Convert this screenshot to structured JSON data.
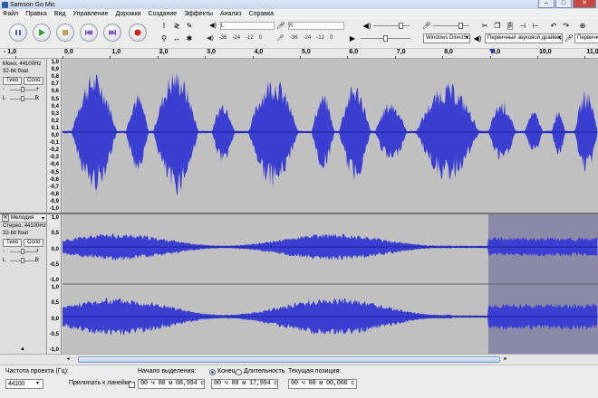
{
  "window": {
    "title": "Samson Go Mic",
    "min": "–",
    "max": "□",
    "close": "✕"
  },
  "menu": [
    "Файл",
    "Правка",
    "Вид",
    "Управление",
    "Дорожки",
    "Создание",
    "Эффекты",
    "Анализ",
    "Справка"
  ],
  "meters": {
    "play_scale": [
      "-36",
      "-24",
      "-12",
      "0"
    ],
    "rec_scale": [
      "-36",
      "-24",
      "-12",
      "0"
    ],
    "lr": [
      "L",
      "R"
    ]
  },
  "devices": {
    "host": "Windows DirectSo",
    "output": "Первичный звуковой драйвер",
    "input": "Первичный драйвер"
  },
  "ruler": {
    "ticks": [
      "- 1,0",
      "0,0",
      "1,0",
      "2,0",
      "3,0",
      "4,0",
      "5,0",
      "6,0",
      "7,0",
      "8,0",
      "9,0",
      "10,0",
      "11,0"
    ]
  },
  "track1": {
    "info": [
      "Моно, 44100Hz",
      "32-bit float"
    ],
    "mute": "Тихо",
    "solo": "Соло",
    "gain_minus": "-",
    "gain_plus": "+",
    "pan_l": "L",
    "pan_r": "R",
    "scale": [
      "1,0",
      "0,9",
      "0,8",
      "0,7",
      "0,6",
      "0,5",
      "0,4",
      "0,3",
      "0,2",
      "0,1",
      "0,0",
      "-0,1",
      "-0,2",
      "-0,3",
      "-0,4",
      "-0,5",
      "-0,6",
      "-0,7",
      "-0,8",
      "-0,9",
      "-1,0"
    ]
  },
  "track2": {
    "name": "Мелодия",
    "info": [
      "Стерео, 44100Hz",
      "32-bit float"
    ],
    "mute": "Тихо",
    "solo": "Соло",
    "gain_minus": "-",
    "gain_plus": "+",
    "pan_l": "L",
    "pan_r": "R",
    "scale_top": [
      "1,0",
      "0,5",
      "0,0",
      "-0,5",
      "-1,0"
    ],
    "scale_bottom": [
      "1,0",
      "0,5",
      "0,0",
      "-0,5",
      "-1,0"
    ]
  },
  "status": {
    "rate_label": "Частота проекта (Гц):",
    "rate_value": "44100",
    "snap_label": "Прилипать к линейке",
    "sel_start_label": "Начало выделения:",
    "end_label": "Конец",
    "length_label": "Длительность",
    "position_label": "Текущая позиция:",
    "sel_start": "00 ч 00 м 08,994 с",
    "sel_end": "00 ч 00 м 17,994 с",
    "position": "00 ч 00 м 00,000 с"
  },
  "colors": {
    "wave": "#3a3fd2",
    "wave_bg": "#c0c0c0",
    "selection": "#8a8aa8",
    "waveline": "#1e22a0"
  }
}
